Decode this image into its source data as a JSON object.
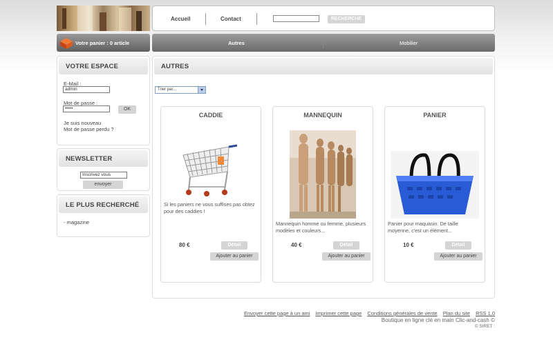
{
  "header": {
    "nav": [
      "Accueil",
      "Contact"
    ],
    "search_placeholder": "",
    "search_button": "RECHERCHE"
  },
  "cart_bar": {
    "label": "Votre panier : 0 article"
  },
  "category_bar": {
    "items": [
      "Autres",
      "Mobilier"
    ]
  },
  "account": {
    "title": "VOTRE ESPACE",
    "email_label": "E-Mail :",
    "email_value": "admin",
    "password_label": "Mot de passe :",
    "password_value": "•••••",
    "ok_button": "OK",
    "register_link": "Je suis nouveau",
    "forgot_link": "Mot de passe perdu ?"
  },
  "newsletter": {
    "title": "NEWSLETTER",
    "input_value": "Inscrivez vous",
    "send_button": "envoyer"
  },
  "popular": {
    "title": "LE PLUS RECHERCHÉ",
    "items": [
      "- magazine"
    ]
  },
  "main": {
    "title": "AUTRES",
    "sort_label": "Trier par...",
    "products": [
      {
        "name": "CADDIE",
        "description": "Si les paniers ne vous suffises pas obtez pour des caddies !",
        "price": "80 €",
        "detail_label": "Détail",
        "add_label": "Ajouter au panier"
      },
      {
        "name": "MANNEQUIN",
        "description": "Mannequin homme ou femme, plusieurs modèles et couleurs...",
        "price": "40 €",
        "detail_label": "Détail",
        "add_label": "Ajouter au panier"
      },
      {
        "name": "PANIER",
        "description": "Panier pour maquasin. De taille moyenne, c'est un élément...",
        "price": "10 €",
        "detail_label": "Détail",
        "add_label": "Ajouter au panier"
      }
    ]
  },
  "footer": {
    "links": [
      "Envoyer cette page à un ami",
      "Imprimer cette page",
      "Conditions générales de vente",
      "Plan du site",
      "RSS 1.0"
    ],
    "tagline": "Boutique en ligne clé en main Clic-and-cash ©",
    "siret": "SIRET :"
  },
  "colors": {
    "accent_orange": "#d9541e",
    "bar_gray": "#6a6a6a",
    "basket_blue": "#2a5bd7"
  }
}
